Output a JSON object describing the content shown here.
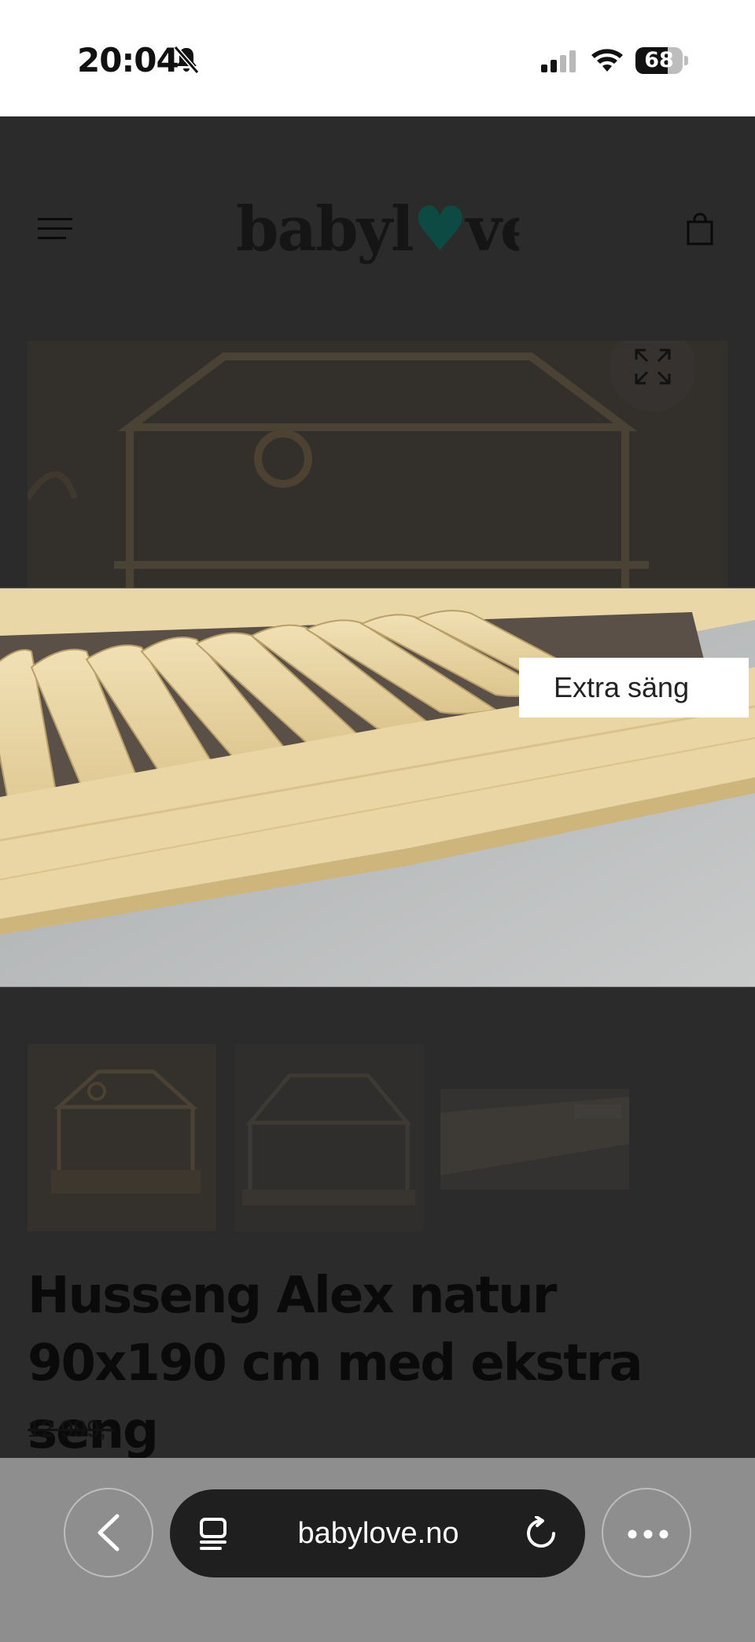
{
  "status_bar": {
    "time": "20:04",
    "battery_level": "68",
    "battery_fraction": 0.68,
    "icons": [
      "bell-slash-icon",
      "cellular-signal-icon",
      "wifi-icon",
      "battery-icon"
    ]
  },
  "header": {
    "logo_text": "babylove",
    "icons": [
      "hamburger-menu-icon",
      "shopping-bag-icon"
    ]
  },
  "gallery": {
    "expand_icon": "expand-arrows-icon",
    "lightbox_label": "Extra säng",
    "thumbnails_count": 3
  },
  "product": {
    "title": "Husseng Alex natur 90x190 cm med ekstra seng",
    "old_price": "12 999,-"
  },
  "browser": {
    "url": "babylove.no",
    "icons": [
      "back-chevron-icon",
      "tabs-icon",
      "reload-icon",
      "more-dots-icon"
    ]
  },
  "colors": {
    "overlay": "#2b2b2b",
    "logo_heart": "#0e4a44",
    "browser_bar": "#8e8e8e",
    "address_pill": "#1f1f1f"
  }
}
